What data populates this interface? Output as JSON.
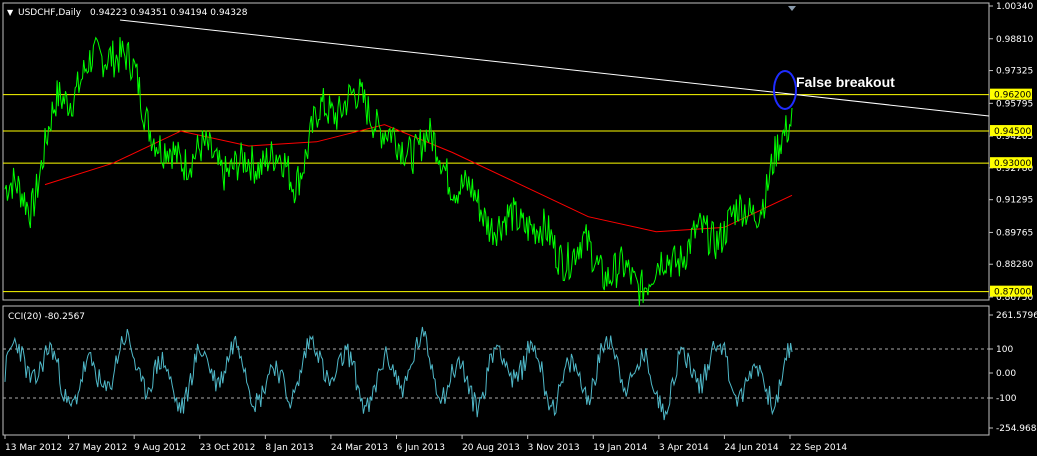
{
  "header": {
    "symbol": "USDCHF,Daily",
    "ohlc": "0.94223 0.94351 0.94194 0.94328"
  },
  "cci_header": "CCI(20) -80.2567",
  "annotation": "False breakout",
  "price_axis": {
    "ticks": [
      "1.00340",
      "0.98810",
      "0.97325",
      "0.95795",
      "0.94265",
      "0.92780",
      "0.91295",
      "0.89765",
      "0.88280",
      "0.86750"
    ],
    "ylim": [
      0.8675,
      1.0034
    ]
  },
  "levels": [
    {
      "value": 0.962,
      "label": "0.96200"
    },
    {
      "value": 0.945,
      "label": "0.94500"
    },
    {
      "value": 0.93,
      "label": "0.93000"
    },
    {
      "value": 0.87,
      "label": "0.87000"
    }
  ],
  "cci_axis": {
    "ticks": [
      "261.5796",
      "100",
      "0.00",
      "-100",
      "-254.9684"
    ]
  },
  "time_axis": [
    "13 Mar 2012",
    "27 May 2012",
    "9 Aug 2012",
    "23 Oct 2012",
    "8 Jan 2013",
    "24 Mar 2013",
    "6 Jun 2013",
    "20 Aug 2013",
    "3 Nov 2013",
    "19 Jan 2014",
    "3 Apr 2014",
    "24 Jun 2014",
    "22 Sep 2014"
  ],
  "colors": {
    "price": "#00ff00",
    "ma": "#ff0000",
    "level": "#ffff00",
    "trendline": "#ffffff",
    "cci": "#4fb8c8",
    "highlight": "#0000ff"
  },
  "chart_data": {
    "type": "line",
    "title": "USDCHF,Daily",
    "x_range": [
      "13 Mar 2012",
      "22 Sep 2014"
    ],
    "ylim": [
      0.8675,
      1.0034
    ],
    "series": [
      {
        "x": [
          "Mar 2012",
          "Apr 2012",
          "May 2012",
          "Jun 2012",
          "Jul 2012",
          "Aug 2012",
          "Sep 2012",
          "Oct 2012",
          "Nov 2012",
          "Dec 2012",
          "Jan 2013",
          "Feb 2013",
          "Mar 2013",
          "Apr 2013",
          "May 2013",
          "Jun 2013",
          "Jul 2013",
          "Aug 2013",
          "Sep 2013",
          "Oct 2013",
          "Nov 2013",
          "Dec 2013",
          "Jan 2014",
          "Feb 2014",
          "Mar 2014",
          "Apr 2014",
          "May 2014",
          "Jun 2014",
          "Jul 2014",
          "Aug 2014",
          "Sep 2014"
        ],
        "values": [
          0.918,
          0.912,
          0.958,
          0.97,
          0.985,
          0.97,
          0.932,
          0.935,
          0.932,
          0.926,
          0.935,
          0.922,
          0.952,
          0.96,
          0.955,
          0.935,
          0.942,
          0.925,
          0.91,
          0.9,
          0.905,
          0.888,
          0.89,
          0.88,
          0.875,
          0.88,
          0.892,
          0.897,
          0.905,
          0.915,
          0.955
        ]
      },
      {
        "x": [
          "Mar 2012",
          "Jun 2012",
          "Sep 2012",
          "Dec 2012",
          "Mar 2013",
          "Jun 2013",
          "Sep 2013",
          "Dec 2013",
          "Mar 2014",
          "May 2014",
          "Jul 2014",
          "Sep 2014"
        ],
        "values": [
          0.92,
          0.93,
          0.945,
          0.938,
          0.94,
          0.948,
          0.935,
          0.92,
          0.905,
          0.898,
          0.9,
          0.915
        ]
      }
    ],
    "grid": false
  }
}
